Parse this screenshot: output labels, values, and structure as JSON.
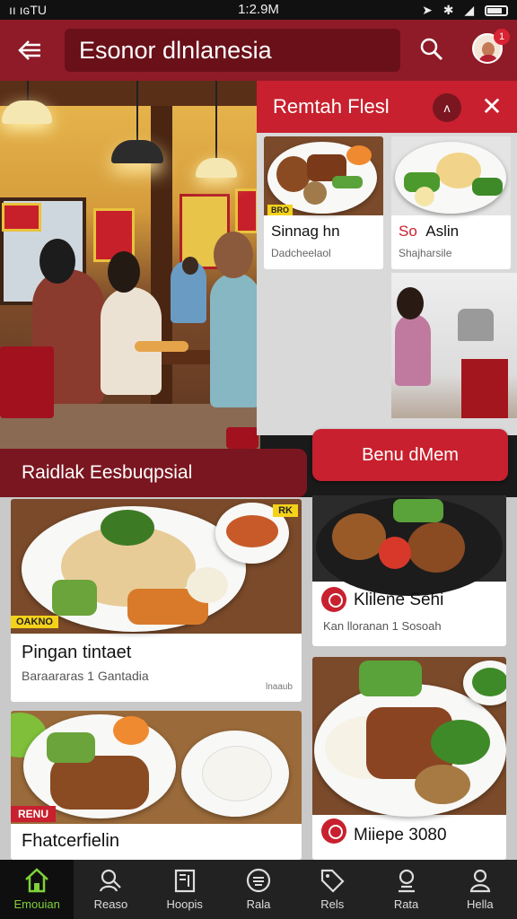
{
  "status_bar": {
    "carrier": "ıı ıɢTU",
    "time": "1:2.9M",
    "icons": [
      "wifi-icon",
      "location-icon",
      "bluetooth-icon",
      "signal-icon",
      "battery-icon"
    ]
  },
  "header": {
    "title": "Esonor dlnlanesia",
    "notification_count": "1",
    "icons": [
      "back-arrow-icon",
      "search-icon",
      "avatar"
    ]
  },
  "right_panel": {
    "title": "Remtah Flesl",
    "toggle_label": "ʌ",
    "cards": [
      {
        "tag": "BRO",
        "title": "Sinnag hn",
        "subtitle": "Dadcheelaol"
      },
      {
        "title_prefix": "So",
        "title": "Aslin",
        "subtitle": "Shajharsile"
      }
    ]
  },
  "menu_cta": {
    "label": "Benu dMem"
  },
  "section_banner": {
    "label": "Raidlak Eesbuqpsial"
  },
  "feed": [
    {
      "corner_tag": "RK",
      "tag": "OAKNO",
      "title": "Pingan tintaet",
      "subtitle": "Baraararas 1 Gantadia",
      "note": "lnaaub"
    },
    {
      "title": "Klilene Sehi",
      "subtitle": "Kan lloranan 1 Sosoah"
    },
    {
      "tag": "RENU",
      "title": "Fhatcerfielin",
      "subtitle": ""
    },
    {
      "title": "Miiepe 3080",
      "subtitle": ""
    }
  ],
  "bottom_nav": [
    {
      "label": "Emouian",
      "icon": "home-icon",
      "active": true
    },
    {
      "label": "Reaso",
      "icon": "search-person-icon",
      "active": false
    },
    {
      "label": "Hoopis",
      "icon": "book-icon",
      "active": false
    },
    {
      "label": "Rala",
      "icon": "menu-circle-icon",
      "active": false
    },
    {
      "label": "Rels",
      "icon": "tag-icon",
      "active": false
    },
    {
      "label": "Rata",
      "icon": "ranking-icon",
      "active": false
    },
    {
      "label": "Hella",
      "icon": "profile-icon",
      "active": false
    }
  ],
  "colors": {
    "header": "#8e1b27",
    "accent": "#c8202e",
    "tag_yellow": "#f5d21a",
    "nav_active": "#7fd23a"
  }
}
